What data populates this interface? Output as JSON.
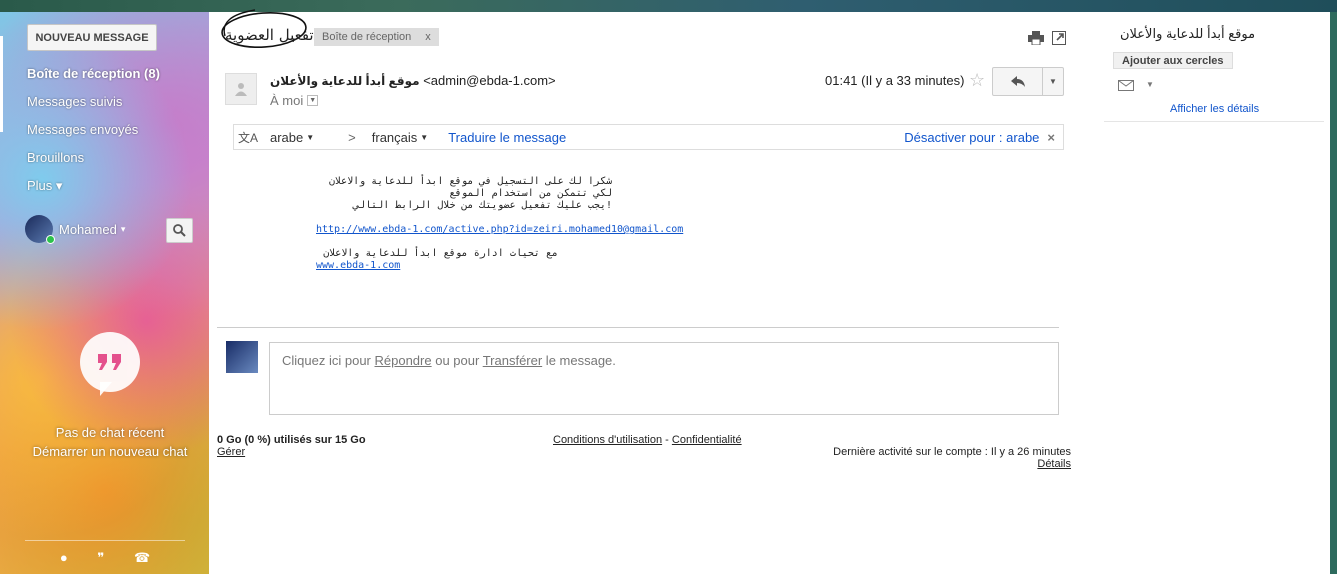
{
  "sidebar": {
    "compose_label": "NOUVEAU MESSAGE",
    "items": [
      {
        "label": "Boîte de réception (8)",
        "active": true
      },
      {
        "label": "Messages suivis"
      },
      {
        "label": "Messages envoyés"
      },
      {
        "label": "Brouillons"
      },
      {
        "label": "Plus ▾"
      }
    ],
    "user_name": "Mohamed",
    "chat_empty": "Pas de chat récent",
    "chat_start": "Démarrer un nouveau chat"
  },
  "header": {
    "subject": "تفعيل العضوية",
    "label": "Boîte de réception",
    "label_close": "x"
  },
  "message": {
    "sender_name": "موقع أبدأ للدعاية والأعلان",
    "sender_email": "<admin@ebda-1.com>",
    "to": "À moi",
    "timestamp": "01:41 (Il y a 33 minutes)",
    "body_line1": "شكرا لك على التسجيل في موقع ابدأ للدعاية والاعلان",
    "body_line2": "لكي تتمكن من استخدام الموقع",
    "body_line3": "!يجب عليك تفعيل عضويتك من خلال الرابط التالي",
    "activation_link": "http://www.ebda-1.com/active.php?id=zeiri.mohamed10@gmail.com",
    "sign_off": "مع تحيات ادارة موقع ابدأ للدعاية والاعلان",
    "site_link": "www.ebda-1.com"
  },
  "translate": {
    "from": "arabe",
    "arrow": ">",
    "to": "français",
    "action": "Traduire le message",
    "disable": "Désactiver pour : arabe",
    "close": "×"
  },
  "reply": {
    "prefix": "Cliquez ici pour ",
    "reply_word": "Répondre",
    "middle": " ou pour ",
    "forward_word": "Transférer",
    "suffix": " le message."
  },
  "footer": {
    "storage": "0 Go (0 %) utilisés sur 15 Go",
    "manage": "Gérer",
    "terms": "Conditions d'utilisation",
    "dash": " - ",
    "privacy": "Confidentialité",
    "last_activity": "Dernière activité sur le compte : Il y a 26 minutes",
    "details": "Détails"
  },
  "right_panel": {
    "contact_name": "موقع أبدأ للدعاية والأعلان",
    "add_circles": "Ajouter aux cercles",
    "show_details": "Afficher les détails"
  }
}
